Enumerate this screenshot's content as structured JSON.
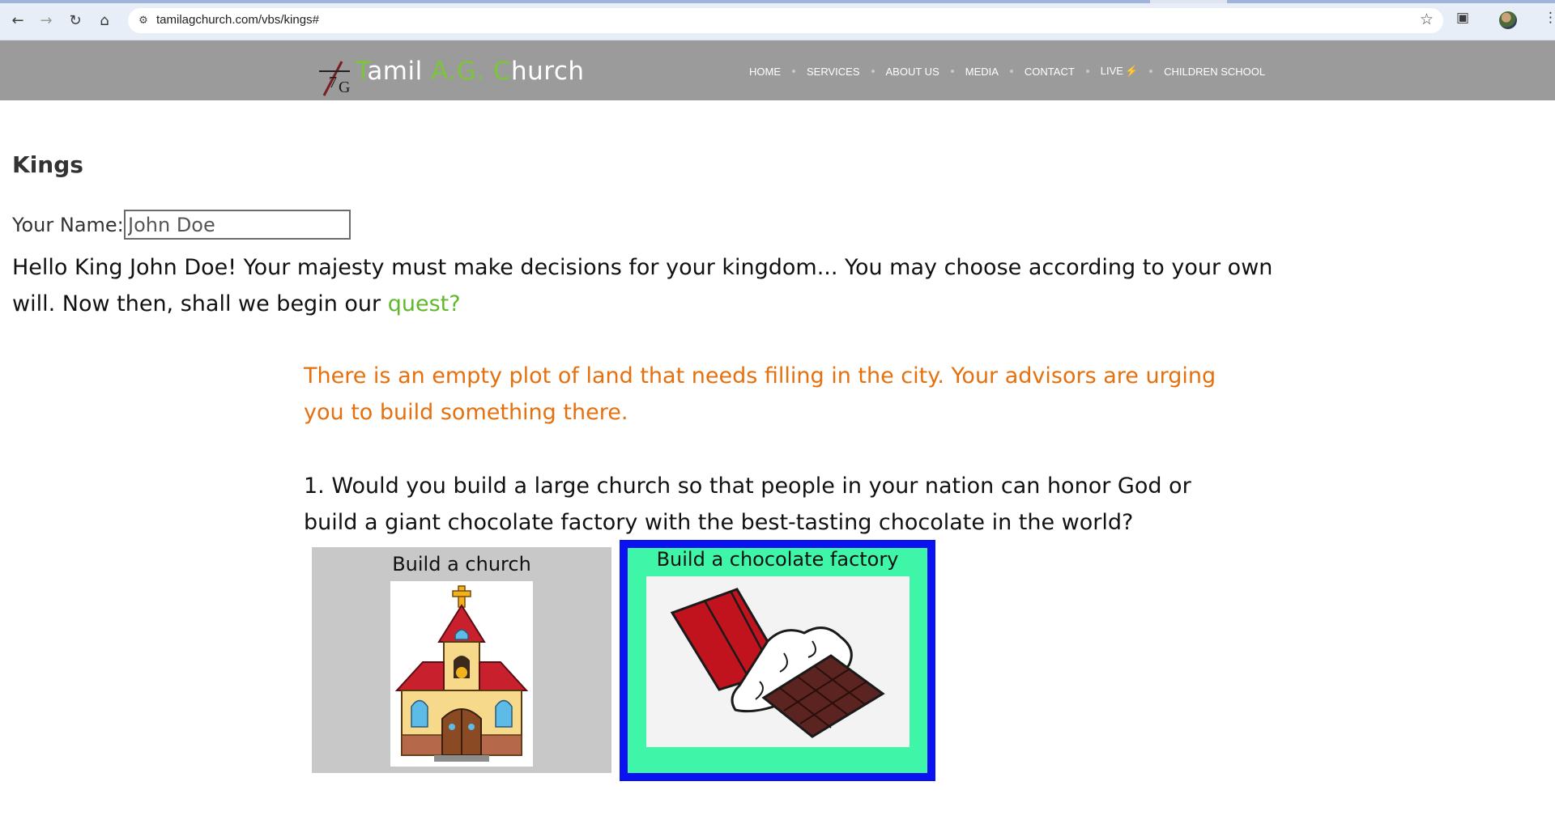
{
  "browser": {
    "url": "tamilagchurch.com/vbs/kings#"
  },
  "header": {
    "logo_parts": [
      "T",
      "amil ",
      "A.G. ",
      "C",
      "hurch"
    ],
    "nav": [
      "HOME",
      "SERVICES",
      "ABOUT US",
      "MEDIA",
      "CONTACT",
      "LIVE",
      "CHILDREN SCHOOL"
    ]
  },
  "page": {
    "title": "Kings",
    "name_label": "Your Name:",
    "name_value": "John Doe",
    "greeting_main": "Hello King John Doe! Your majesty must make decisions for your kingdom... You may choose according to your own will. Now then, shall we begin our ",
    "greeting_link": "quest?",
    "scenario": "There is an empty plot of land that needs filling in the city. Your advisors are urging you to build something there.",
    "question": "1. Would you build a large church so that people in your nation can honor God or build a giant chocolate factory with the best-tasting chocolate in the world?",
    "choices": [
      {
        "label": "Build a church",
        "image": "church-illustration"
      },
      {
        "label": "Build a chocolate factory",
        "image": "chocolate-bar-illustration"
      }
    ]
  },
  "colors": {
    "header_bg": "#9b9b9b",
    "accent_green": "#7cc43a",
    "scenario_orange": "#e5700d",
    "selected_border": "#0a12f0",
    "selected_bg": "#3ef5a8",
    "unselected_bg": "#c8c8c8"
  }
}
